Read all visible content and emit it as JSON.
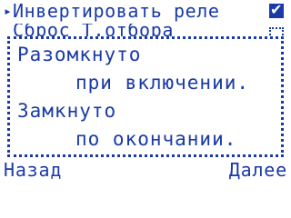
{
  "menu": {
    "items": [
      {
        "label": "Инвертировать реле",
        "checked": true,
        "selected": true
      },
      {
        "label": "Сброс Т.отбора",
        "checked": false,
        "selected": false
      }
    ]
  },
  "popup": {
    "lines": [
      "Разомкнуто",
      "при включении.",
      "Замкнуто",
      "по окончании."
    ]
  },
  "softkeys": {
    "back_label": "Назад",
    "next_label": "Далее"
  },
  "colors": {
    "foreground": "#1a3aa8",
    "background": "#ffffff"
  },
  "icons": {
    "pointer": "triangle-right-icon",
    "checked": "checkbox-checked-icon",
    "unchecked": "checkbox-unchecked-icon"
  }
}
